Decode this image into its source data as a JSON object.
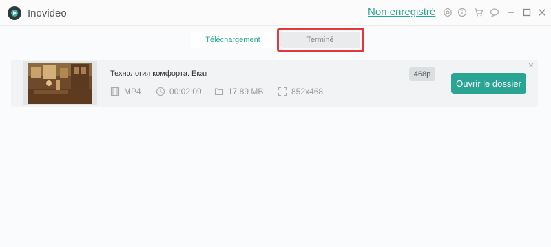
{
  "app": {
    "title": "Inovideo",
    "register_link": "Non enregistré"
  },
  "window_icons": [
    "settings-icon",
    "info-icon",
    "cart-icon",
    "feedback-icon",
    "minimize-icon",
    "maximize-icon",
    "close-icon"
  ],
  "tabs": [
    {
      "label": "Téléchargement",
      "active": true
    },
    {
      "label": "Terminé",
      "active": false,
      "highlighted": true
    }
  ],
  "items": [
    {
      "title": "Технология комфорта. Екат",
      "format": "MP4",
      "duration": "00:02:09",
      "size": "17.89 MB",
      "resolution": "852x468",
      "quality": "468p",
      "action": "Ouvrir le dossier"
    }
  ],
  "colors": {
    "accent": "#2aa594",
    "highlight": "#e0393d"
  }
}
